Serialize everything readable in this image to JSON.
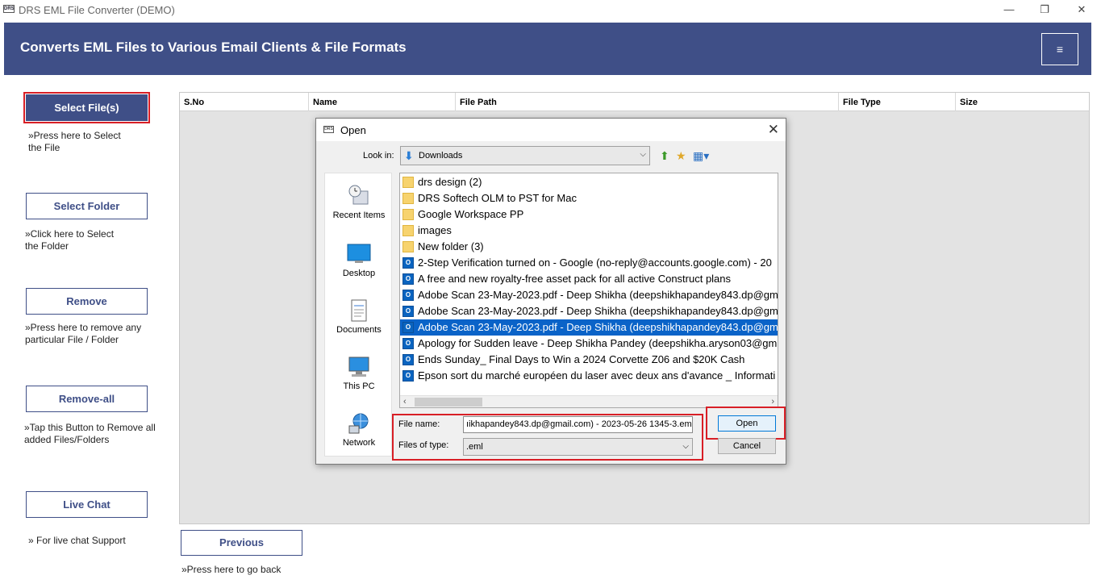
{
  "window": {
    "title": "DRS EML File Converter (DEMO)",
    "app_icon_text": "DRS",
    "minimize": "—",
    "restore": "❐",
    "close": "✕"
  },
  "banner": {
    "heading": "Converts EML Files to Various Email Clients & File Formats",
    "menu_icon": "≡"
  },
  "sidebar": {
    "select_files": {
      "label": "Select File(s)",
      "hint_line1": "»Press here to Select",
      "hint_line2": "the File"
    },
    "select_folder": {
      "label": "Select Folder",
      "hint_line1": "»Click here to Select",
      "hint_line2": "the Folder"
    },
    "remove": {
      "label": "Remove",
      "hint_line1": "»Press here to remove any",
      "hint_line2": "particular File / Folder"
    },
    "remove_all": {
      "label": "Remove-all",
      "hint_line1": "»Tap this Button to Remove all",
      "hint_line2": "added Files/Folders"
    },
    "live_chat": {
      "label": "Live Chat",
      "hint_line1": "» For live chat Support"
    }
  },
  "table": {
    "columns": [
      "S.No",
      "Name",
      "File Path",
      "File Type",
      "Size"
    ]
  },
  "footer": {
    "previous_label": "Previous",
    "previous_hint": "»Press here to go back"
  },
  "dialog": {
    "title": "Open",
    "icon_text": "DRS",
    "close": "✕",
    "look_in_label": "Look in:",
    "look_in_value": "Downloads",
    "places": [
      "Recent Items",
      "Desktop",
      "Documents",
      "This PC",
      "Network"
    ],
    "files": [
      {
        "name": "drs design (2)",
        "type": "folder"
      },
      {
        "name": "DRS Softech OLM to PST for Mac",
        "type": "folder"
      },
      {
        "name": "Google Workspace PP",
        "type": "folder"
      },
      {
        "name": "images",
        "type": "folder"
      },
      {
        "name": "New folder (3)",
        "type": "folder"
      },
      {
        "name": "2-Step Verification turned on - Google (no-reply@accounts.google.com) - 20",
        "type": "mail"
      },
      {
        "name": "A free and new royalty-free asset pack for all active Construct plans",
        "type": "mail"
      },
      {
        "name": "Adobe Scan 23-May-2023.pdf - Deep Shikha (deepshikhapandey843.dp@gm",
        "type": "mail"
      },
      {
        "name": "Adobe Scan 23-May-2023.pdf - Deep Shikha (deepshikhapandey843.dp@gm",
        "type": "mail"
      },
      {
        "name": "Adobe Scan 23-May-2023.pdf - Deep Shikha (deepshikhapandey843.dp@gm",
        "type": "mail",
        "selected": true
      },
      {
        "name": "Apology for Sudden leave - Deep Shikha Pandey (deepshikha.aryson03@gma",
        "type": "mail"
      },
      {
        "name": "Ends Sunday_ Final Days to Win a 2024 Corvette Z06 and $20K Cash",
        "type": "mail"
      },
      {
        "name": "Epson sort du marché européen du laser avec deux ans d'avance _ Informati",
        "type": "mail"
      }
    ],
    "file_name_label": "File name:",
    "file_name_value": "ıikhapandey843.dp@gmail.com) - 2023-05-26 1345-3.eml",
    "files_of_type_label": "Files of type:",
    "files_of_type_value": ".eml",
    "open_label": "Open",
    "cancel_label": "Cancel",
    "mail_icon_text": "O",
    "scroll_left": "‹",
    "scroll_right": "›"
  },
  "colors": {
    "brand": "#3f4f87",
    "highlight": "#d81f26",
    "selection": "#0a63c8"
  }
}
